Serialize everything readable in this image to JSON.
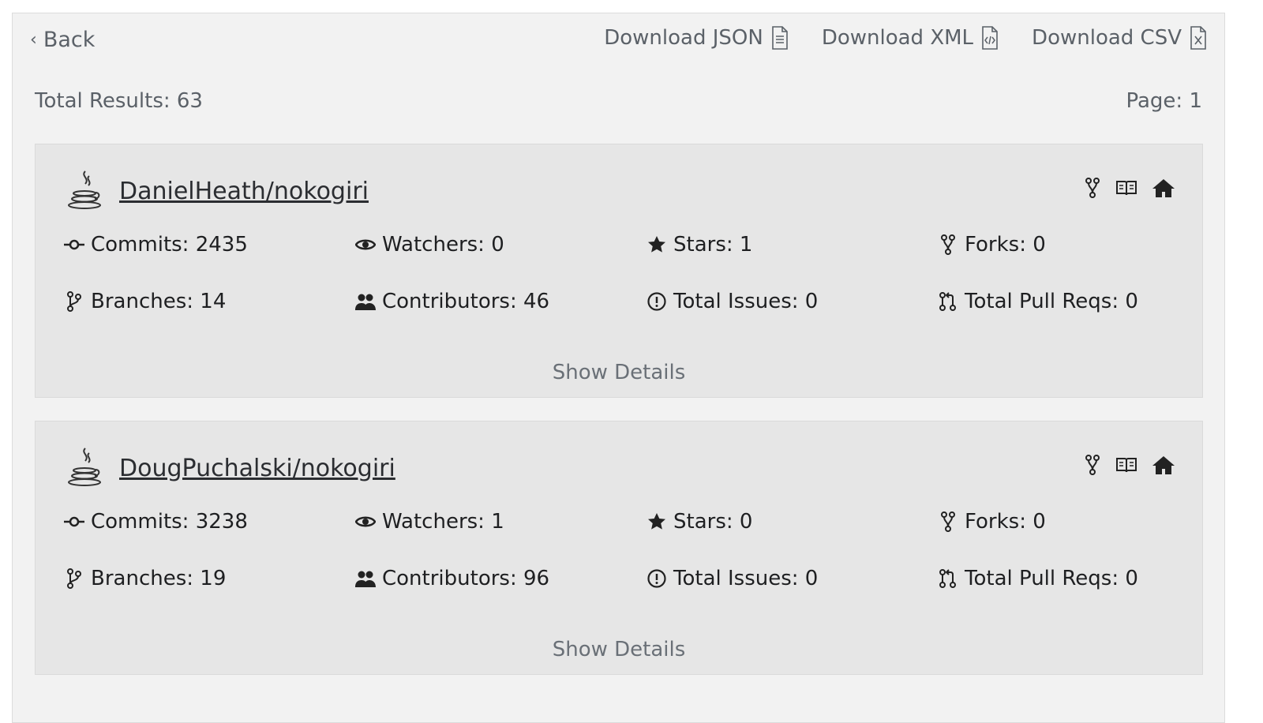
{
  "header": {
    "back_label": "Back",
    "downloads": [
      {
        "label": "Download JSON",
        "icon": "file-text-icon"
      },
      {
        "label": "Download XML",
        "icon": "file-code-icon"
      },
      {
        "label": "Download CSV",
        "icon": "file-excel-icon"
      }
    ]
  },
  "summary": {
    "total_results": "Total Results: 63",
    "page": "Page: 1"
  },
  "results": [
    {
      "repo": "DanielHeath/nokogiri",
      "language_icon": "java-icon",
      "commits": "Commits: 2435",
      "watchers": "Watchers: 0",
      "stars": "Stars: 1",
      "forks": "Forks: 0",
      "branches": "Branches: 14",
      "contributors": "Contributors: 46",
      "issues": "Total Issues: 0",
      "pull_reqs": "Total Pull Reqs: 0",
      "details_label": "Show Details"
    },
    {
      "repo": "DougPuchalski/nokogiri",
      "language_icon": "java-icon",
      "commits": "Commits: 3238",
      "watchers": "Watchers: 1",
      "stars": "Stars: 0",
      "forks": "Forks: 0",
      "branches": "Branches: 19",
      "contributors": "Contributors: 96",
      "issues": "Total Issues: 0",
      "pull_reqs": "Total Pull Reqs: 0",
      "details_label": "Show Details"
    }
  ],
  "colors": {
    "panel_bg": "#f2f2f2",
    "card_bg": "#e6e6e6",
    "muted_text": "#5b6168",
    "text": "#1e1f21"
  }
}
